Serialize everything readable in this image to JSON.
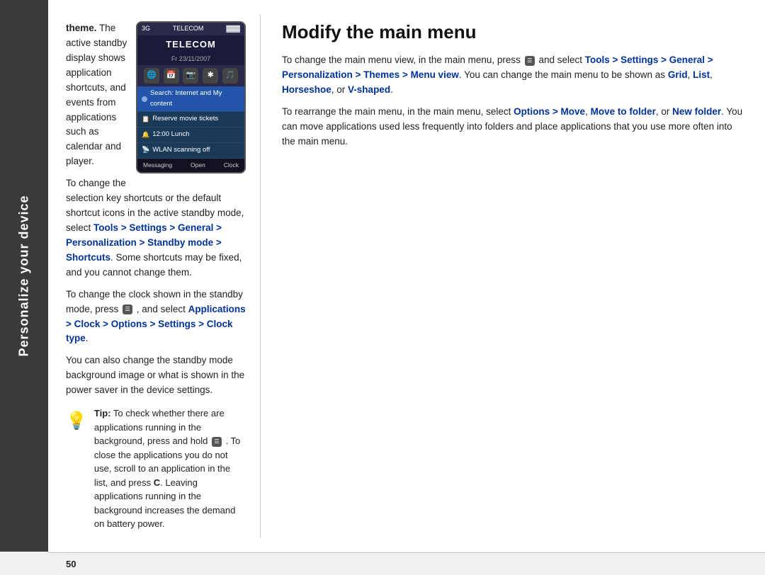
{
  "sidebar": {
    "label": "Personalize your device"
  },
  "left_col": {
    "para1_prefix": "theme.",
    "para1_text": "  The active standby display shows application shortcuts, and events from applications such as calendar and player.",
    "para2_prefix": "To change the selection key shortcuts or the default shortcut icons in the active standby mode, select ",
    "para2_link1": "Tools > Settings > General > Personalization > Standby mode > Shortcuts",
    "para2_suffix": ". Some shortcuts may be fixed, and you cannot change them.",
    "para3_prefix": "To change the clock shown in the standby mode, press",
    "para3_link": "Applications > Clock > Options > Settings > Clock type",
    "para3_suffix": ".",
    "para4": "You can also change the standby mode background image or what is shown in the power saver in the device settings.",
    "tip_label": "Tip:",
    "tip_text": "  To check whether there are applications running in the background, press and hold",
    "tip_text2": " .  To close the applications you do not use, scroll to an application in the list, and press C. Leaving applications running in the background increases the demand on battery power.",
    "phone": {
      "carrier": "TELECOM",
      "signal": "3G",
      "date": "Fr 23/11/2007",
      "search_item": "Search: Internet and My content",
      "item1": "Reserve movie tickets",
      "item2": "12:00 Lunch",
      "item3": "WLAN scanning off",
      "btn_left": "Messaging",
      "btn_mid": "Open",
      "btn_right": "Clock"
    }
  },
  "right_col": {
    "heading": "Modify the main menu",
    "para1_prefix": "To change the main menu view, in the main menu, press",
    "para1_mid": " and select ",
    "para1_link1": "Tools > Settings > General > Personalization > Themes > Menu view",
    "para1_suffix": ". You can change the main menu to be shown as ",
    "para1_grid": "Grid",
    "para1_list": "List",
    "para1_horseshoe": "Horseshoe",
    "para1_vshaped": "V-shaped",
    "para1_end": ".",
    "para2": "To rearrange the main menu, in the main menu, select ",
    "para2_link1": "Options > Move",
    "para2_comma": ", ",
    "para2_link2": "Move to folder",
    "para2_or": ", or ",
    "para2_link3": "New folder",
    "para2_suffix": ". You can move applications used less frequently into folders and place applications that you use more often into the main menu."
  },
  "footer": {
    "page_number": "50"
  }
}
